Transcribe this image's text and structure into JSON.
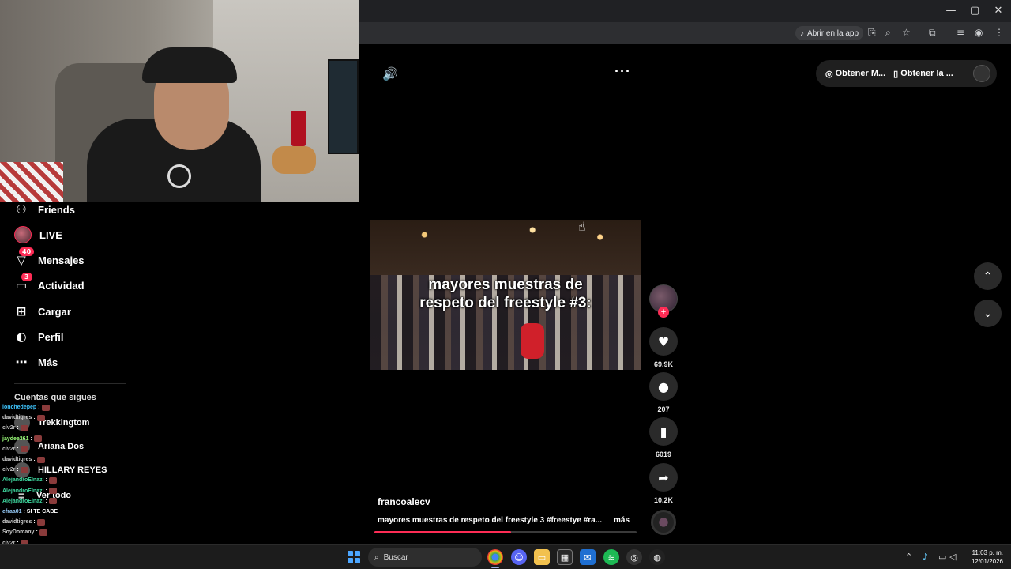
{
  "browser": {
    "open_in_app": "Abrir en la app",
    "win_minimize": "—",
    "win_restore": "▢",
    "win_close": "✕"
  },
  "sidebar": {
    "items": [
      {
        "label": "Friends",
        "icon": "friends-icon"
      },
      {
        "label": "LIVE",
        "icon": "live-avatar"
      },
      {
        "label": "Mensajes",
        "icon": "messages-icon",
        "badge": "40"
      },
      {
        "label": "Actividad",
        "icon": "activity-icon",
        "badge": "3"
      },
      {
        "label": "Cargar",
        "icon": "upload-icon"
      },
      {
        "label": "Perfil",
        "icon": "profile-icon"
      },
      {
        "label": "Más",
        "icon": "more-icon"
      }
    ],
    "following_title": "Cuentas que sigues",
    "following": [
      "Trekkingtom",
      "Ariana Dos",
      "HILLARY REYES"
    ],
    "see_all": "Ver todo"
  },
  "chat": [
    {
      "user": "lonchedepep",
      "color": "#3fc6ff",
      "text": ":"
    },
    {
      "user": "davidtigres",
      "color": "#cccccc",
      "text": ":"
    },
    {
      "user": "clv2r",
      "color": "#bbbbbb",
      "text": ":"
    },
    {
      "user": "jaydee361",
      "color": "#9cff7a",
      "text": ":"
    },
    {
      "user": "clv2r",
      "color": "#bbbbbb",
      "text": ":"
    },
    {
      "user": "davidtigres",
      "color": "#cccccc",
      "text": ":"
    },
    {
      "user": "clv2r",
      "color": "#bbbbbb",
      "text": ":"
    },
    {
      "user": "AlejandroElnazi",
      "color": "#3fd9a0",
      "text": ":"
    },
    {
      "user": "AlejandroElnazi",
      "color": "#3fd9a0",
      "text": ":"
    },
    {
      "user": "AlejandroElnazi",
      "color": "#3fd9a0",
      "text": ":"
    },
    {
      "user": "efraa01",
      "color": "#9ad0ff",
      "text": ": SI TE CABE"
    },
    {
      "user": "davidtigres",
      "color": "#cccccc",
      "text": ":"
    },
    {
      "user": "SoyDomany",
      "color": "#cccccc",
      "text": ":"
    },
    {
      "user": "clv2r",
      "color": "#bbbbbb",
      "text": ":"
    },
    {
      "user": "lonchedepep",
      "color": "#3fc6ff",
      "text": ":"
    },
    {
      "user": "clv2r",
      "color": "#bbbbbb",
      "text": ":"
    }
  ],
  "top_bar": {
    "btn1": "Obtener M...",
    "btn2": "Obtener la ..."
  },
  "video": {
    "caption_line1": "mayores muestras de",
    "caption_line2": "respeto del freestyle #3:",
    "author": "francoalecv",
    "description": "mayores muestras de respeto del freestyle 3 #freestye #ra...",
    "more": "más",
    "progress_percent": 52
  },
  "actions": {
    "likes": "69.9K",
    "comments": "207",
    "saves": "6019",
    "shares": "10.2K"
  },
  "taskbar": {
    "search_placeholder": "Buscar",
    "time": "11:03 p. m.",
    "date": "12/01/2026"
  },
  "colors": {
    "accent": "#fe2c55",
    "background": "#000000"
  }
}
